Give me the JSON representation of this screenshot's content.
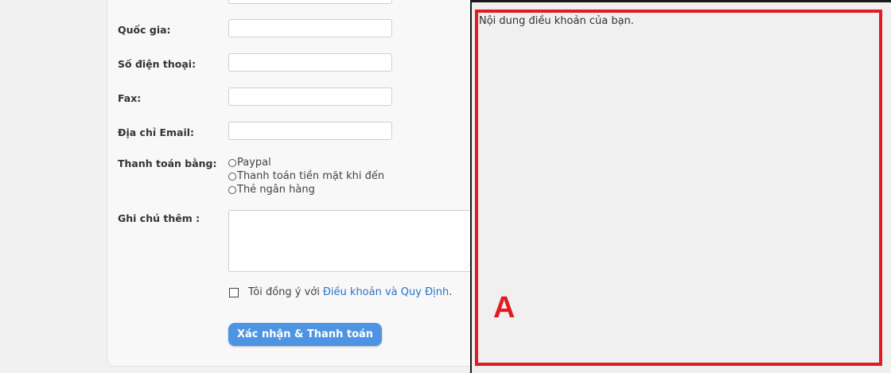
{
  "form": {
    "country_label": "Quốc gia:",
    "phone_label": "Số điện thoại:",
    "fax_label": "Fax:",
    "email_label": "Địa chỉ Email:",
    "payment_label": "Thanh toán bằng:",
    "payment_options": [
      "Paypal",
      "Thanh toán tiền mặt khi đến",
      "Thẻ ngân hàng"
    ],
    "notes_label": "Ghi chú thêm :",
    "agree_text": "Tôi đồng ý với",
    "agree_link": "Điều khoản và Quy Định",
    "agree_period": ".",
    "submit_label": "Xác nhận & Thanh toán"
  },
  "panel": {
    "terms_text": "Nội dung điều khoản của bạn.",
    "marker": "A"
  },
  "colors": {
    "accent": "#4d95e3",
    "link": "#2a73c7",
    "marker": "#e21b23"
  }
}
